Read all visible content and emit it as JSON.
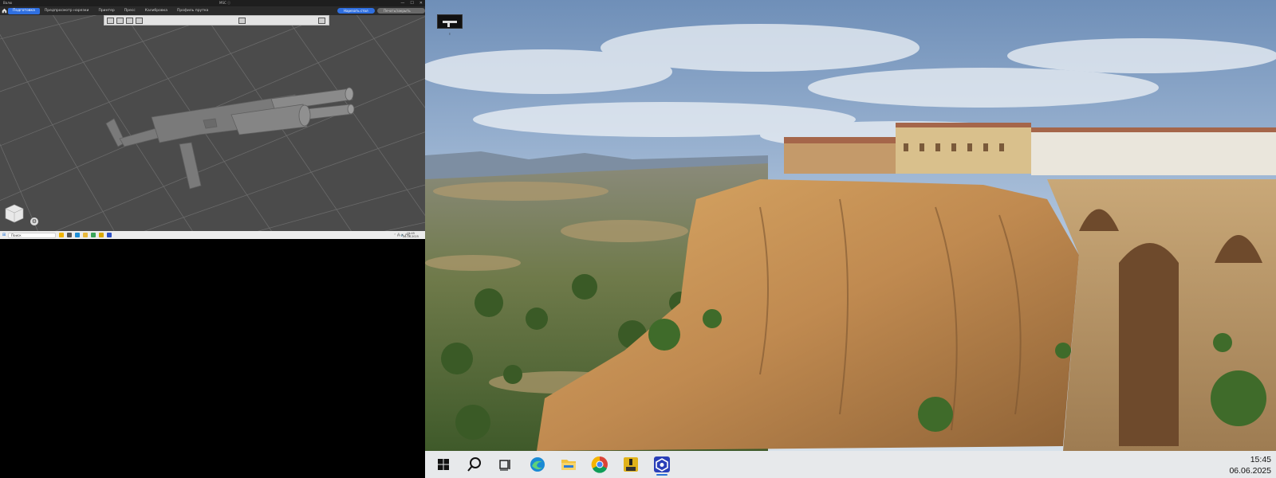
{
  "left_monitor": {
    "titlebar": {
      "app_label": "Валю",
      "doc_title": "MSC ⓘ",
      "controls": [
        "—",
        "☐",
        "✕"
      ]
    },
    "ribbon": {
      "tabs": [
        {
          "label": "Подготовка",
          "active": true
        },
        {
          "label": "Предпросмотр нарезки",
          "active": false
        },
        {
          "label": "Принтер",
          "active": false
        },
        {
          "label": "Пресс",
          "active": false
        },
        {
          "label": "Калибровка",
          "active": false
        },
        {
          "label": "Профиль пруткa",
          "active": false
        }
      ],
      "primary_button": "Нарезать стол",
      "secondary_button": "Печать/закрыть стол"
    },
    "taskbar": {
      "search_placeholder": "Поиск",
      "tray_text": "⌃ 🖧 🔊 РУС",
      "time": "15:45",
      "date": "06.06.2025"
    }
  },
  "right_monitor": {
    "desktop_icon_label": "ı",
    "taskbar": {
      "items": [
        "windows-start",
        "search",
        "task-view",
        "edge",
        "file-explorer",
        "chrome",
        "pro-app",
        "bambu-studio"
      ],
      "time": "15:45",
      "date": "06.06.2025"
    }
  }
}
